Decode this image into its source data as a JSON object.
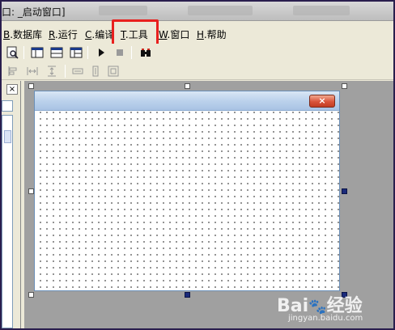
{
  "title_bar": {
    "title": "口: _启动窗口]"
  },
  "menu": {
    "items": [
      {
        "accel": "B",
        "text": ".数据库"
      },
      {
        "accel": "R",
        "text": ".运行"
      },
      {
        "accel": "C",
        "text": ".编译"
      },
      {
        "accel": "T",
        "text": ".工具"
      },
      {
        "accel": "W",
        "text": ".窗口"
      },
      {
        "accel": "H",
        "text": ".帮助"
      }
    ],
    "highlighted_item": "T.工具",
    "highlight_color": "#e8201e"
  },
  "toolbar": {
    "icons": [
      "preview-icon",
      "window-layout-icon",
      "window-layout-2-icon",
      "window-layout-3-icon",
      "run-icon",
      "stop-icon",
      "binoculars-icon"
    ]
  },
  "align_toolbar": {
    "icons": [
      "align-left-icon",
      "space-horizontal-icon",
      "align-center-icon",
      "same-width-icon",
      "same-height-icon",
      "same-size-icon"
    ]
  },
  "left_panel": {
    "close_glyph": "×"
  },
  "form": {
    "close_glyph": "×",
    "titlebar_color": "#bcd2ec"
  },
  "watermark": {
    "brand": "Bai",
    "brand2": "经验",
    "url": "jingyan.baidu.com"
  }
}
